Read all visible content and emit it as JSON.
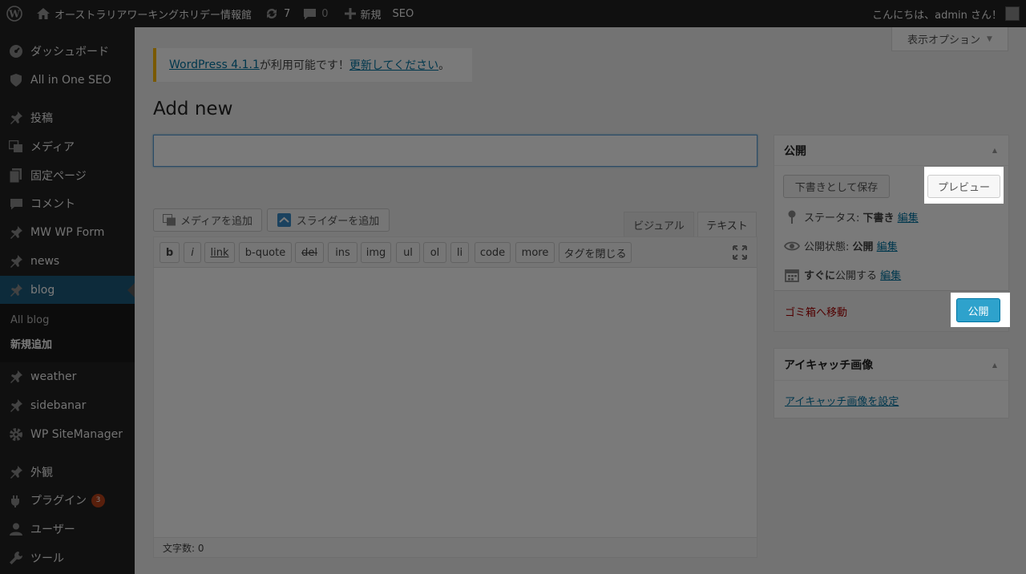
{
  "adminbar": {
    "site_name": "オーストラリアワーキングホリデー情報館",
    "updates_count": "7",
    "comments_count": "0",
    "new_label": "新規",
    "seo_label": "SEO",
    "greeting": "こんにちは、admin さん！"
  },
  "sidebar": {
    "items": [
      {
        "label": "ダッシュボード",
        "icon": "dashboard-icon"
      },
      {
        "label": "All in One SEO",
        "icon": "shield-icon"
      },
      {
        "label": "投稿",
        "icon": "pin-icon"
      },
      {
        "label": "メディア",
        "icon": "media-icon"
      },
      {
        "label": "固定ページ",
        "icon": "page-icon"
      },
      {
        "label": "コメント",
        "icon": "comment-icon"
      },
      {
        "label": "MW WP Form",
        "icon": "pin-icon"
      },
      {
        "label": "news",
        "icon": "pin-icon"
      },
      {
        "label": "blog",
        "icon": "pin-icon"
      },
      {
        "label": "weather",
        "icon": "pin-icon"
      },
      {
        "label": "sidebanar",
        "icon": "pin-icon"
      },
      {
        "label": "WP SiteManager",
        "icon": "gear-icon"
      },
      {
        "label": "外観",
        "icon": "brush-icon"
      },
      {
        "label": "プラグイン",
        "icon": "plugin-icon",
        "badge": "3"
      },
      {
        "label": "ユーザー",
        "icon": "user-icon"
      },
      {
        "label": "ツール",
        "icon": "wrench-icon"
      }
    ],
    "submenu": {
      "all": "All blog",
      "add_new": "新規追加"
    }
  },
  "screen_options": "表示オプション",
  "notice": {
    "version_link": "WordPress 4.1.1",
    "middle": " が利用可能です！",
    "update_link": "更新してください",
    "end": "。"
  },
  "page_title": "Add new",
  "title_input": {
    "value": "",
    "placeholder": ""
  },
  "editor": {
    "add_media": "メディアを追加",
    "add_slider": "スライダーを追加",
    "tab_visual": "ビジュアル",
    "tab_text": "テキスト",
    "quicktags": [
      "b",
      "i",
      "link",
      "b-quote",
      "del",
      "ins",
      "img",
      "ul",
      "ol",
      "li",
      "code",
      "more",
      "タグを閉じる"
    ],
    "word_count": "文字数: 0"
  },
  "publish_box": {
    "title": "公開",
    "save_draft": "下書きとして保存",
    "preview": "プレビュー",
    "status_label": "ステータス:",
    "status_value": "下書き",
    "visibility_label": "公開状態:",
    "visibility_value": "公開",
    "schedule_label": "すぐに",
    "schedule_suffix": "公開する",
    "edit": "編集",
    "trash": "ゴミ箱へ移動",
    "publish": "公開"
  },
  "featured_box": {
    "title": "アイキャッチ画像",
    "set_link": "アイキャッチ画像を設定"
  }
}
